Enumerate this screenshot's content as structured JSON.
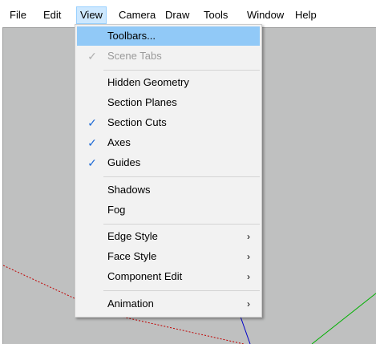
{
  "menubar": {
    "items": [
      {
        "label": "File"
      },
      {
        "label": "Edit"
      },
      {
        "label": "View"
      },
      {
        "label": "Camera"
      },
      {
        "label": "Draw"
      },
      {
        "label": "Tools"
      },
      {
        "label": "Window"
      },
      {
        "label": "Help"
      }
    ],
    "active": "View"
  },
  "view_menu": {
    "items": [
      {
        "label": "Toolbars...",
        "checked": false,
        "enabled": true,
        "highlighted": true,
        "submenu": false
      },
      {
        "label": "Scene Tabs",
        "checked": true,
        "enabled": false,
        "highlighted": false,
        "submenu": false
      },
      {
        "label": "Hidden Geometry",
        "checked": false,
        "enabled": true,
        "highlighted": false,
        "submenu": false
      },
      {
        "label": "Section Planes",
        "checked": false,
        "enabled": true,
        "highlighted": false,
        "submenu": false
      },
      {
        "label": "Section Cuts",
        "checked": true,
        "enabled": true,
        "highlighted": false,
        "submenu": false
      },
      {
        "label": "Axes",
        "checked": true,
        "enabled": true,
        "highlighted": false,
        "submenu": false
      },
      {
        "label": "Guides",
        "checked": true,
        "enabled": true,
        "highlighted": false,
        "submenu": false
      },
      {
        "label": "Shadows",
        "checked": false,
        "enabled": true,
        "highlighted": false,
        "submenu": false
      },
      {
        "label": "Fog",
        "checked": false,
        "enabled": true,
        "highlighted": false,
        "submenu": false
      },
      {
        "label": "Edge Style",
        "checked": false,
        "enabled": true,
        "highlighted": false,
        "submenu": true
      },
      {
        "label": "Face Style",
        "checked": false,
        "enabled": true,
        "highlighted": false,
        "submenu": true
      },
      {
        "label": "Component Edit",
        "checked": false,
        "enabled": true,
        "highlighted": false,
        "submenu": true
      },
      {
        "label": "Animation",
        "checked": false,
        "enabled": true,
        "highlighted": false,
        "submenu": true
      }
    ],
    "check_glyph": "✓",
    "submenu_glyph": "›"
  },
  "colors": {
    "highlight": "#91c9f7",
    "active_menubar": "#cde8ff",
    "viewport_bg": "#bfc0c0",
    "axis_red": "#c00000",
    "axis_green": "#00b000",
    "axis_blue": "#0000c8"
  }
}
